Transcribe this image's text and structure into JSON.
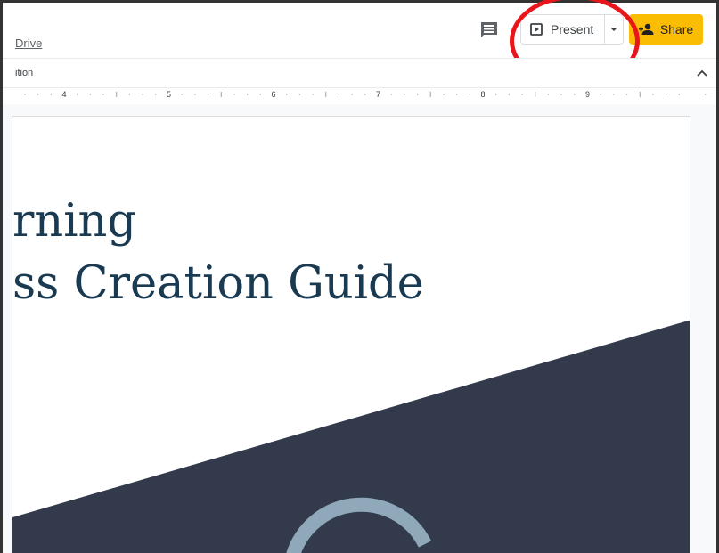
{
  "header": {
    "drive_link": "Drive",
    "present_label": "Present",
    "share_label": "Share"
  },
  "toolbar": {
    "partial_label": "ition"
  },
  "ruler": {
    "numbers": [
      "4",
      "5",
      "6",
      "7",
      "8",
      "9"
    ]
  },
  "slide": {
    "title_line_1": "rning",
    "title_line_2": "ss Creation Guide"
  },
  "colors": {
    "share_button": "#fbbc04",
    "slide_title": "#1a3a52",
    "slide_band": "#323a4c",
    "annotation_circle": "#e8151b"
  },
  "icons": {
    "comment": "comment-icon",
    "present": "present-icon",
    "dropdown": "caret-down-icon",
    "share": "person-add-icon",
    "collapse": "chevron-up-icon"
  }
}
